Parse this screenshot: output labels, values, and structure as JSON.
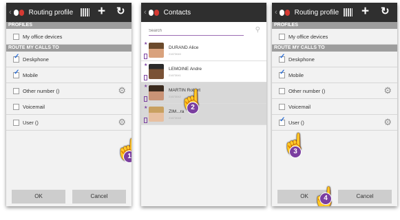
{
  "screen1": {
    "title": "Routing profile",
    "section_profiles": "PROFILES",
    "item_my_office_devices": "My office devices",
    "section_route": "ROUTE MY CALLS TO",
    "items": [
      {
        "label": "Deskphone",
        "checked": true
      },
      {
        "label": "Mobile",
        "checked": true
      },
      {
        "label": "Other number ()",
        "checked": false
      },
      {
        "label": "Voicemail",
        "checked": false
      },
      {
        "label": "User ()",
        "checked": false
      }
    ],
    "ok": "OK",
    "cancel": "Cancel",
    "step": "1"
  },
  "screen2": {
    "title": "Contacts",
    "search_placeholder": "Search",
    "contacts": [
      {
        "name": "DURAND Alice",
        "number": "21673040"
      },
      {
        "name": "LEMOINE Andre",
        "number": "21673041"
      },
      {
        "name": "MARTIN Robert",
        "number": "21673042"
      },
      {
        "name": "ZIM...ra",
        "number": "21673048"
      }
    ],
    "step": "2"
  },
  "screen3": {
    "title": "Routing profile",
    "section_profiles": "PROFILES",
    "item_my_office_devices": "My office devices",
    "section_route": "ROUTE MY CALLS TO",
    "items": [
      {
        "label": "Deskphone",
        "checked": true
      },
      {
        "label": "Mobile",
        "checked": true
      },
      {
        "label": "Other number ()",
        "checked": false
      },
      {
        "label": "Voicemail",
        "checked": false
      },
      {
        "label": "User ()",
        "checked": true
      }
    ],
    "ok": "OK",
    "cancel": "Cancel",
    "step3": "3",
    "step4": "4"
  },
  "colors": {
    "action_bar": "#2f2f2f",
    "section": "#9d9d9d",
    "accent": "#7b3fa0",
    "check": "#2a6cd2"
  },
  "icons": {
    "back": "chevron-left-icon",
    "logo": "app-logo-icon",
    "qr": "qr-code-icon",
    "add": "plus-icon",
    "refresh": "refresh-icon",
    "settings": "gear-icon",
    "search": "search-icon",
    "pointer": "hand-pointer-icon"
  }
}
